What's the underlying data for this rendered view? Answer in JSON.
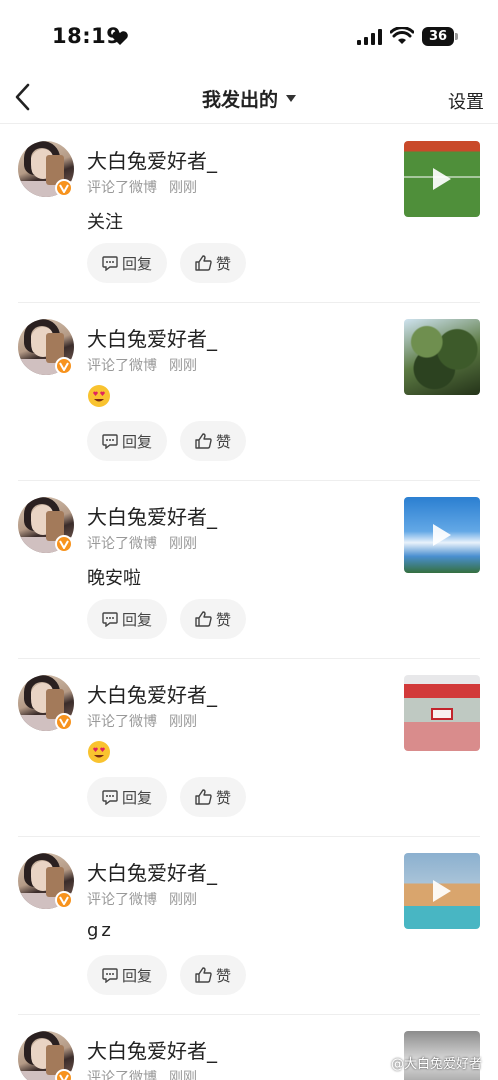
{
  "status_bar": {
    "time": "18:19",
    "battery": "36"
  },
  "header": {
    "title": "我发出的",
    "settings_label": "设置"
  },
  "colors": {
    "badge": "#f7931e",
    "pill_bg": "#f4f4f4",
    "meta_text": "#999999"
  },
  "items": [
    {
      "user": "大白兔爱好者_",
      "action": "评论了微博",
      "time": "刚刚",
      "comment": "关注",
      "thumbnail": "soccer-video-thumbnail",
      "is_video": true,
      "reply_label": "回复",
      "like_label": "赞"
    },
    {
      "user": "大白兔爱好者_",
      "action": "评论了微博",
      "time": "刚刚",
      "comment_emoji": "heart-eyes-emoji",
      "thumbnail": "tree-photo-thumbnail",
      "is_video": false,
      "reply_label": "回复",
      "like_label": "赞"
    },
    {
      "user": "大白兔爱好者_",
      "action": "评论了微博",
      "time": "刚刚",
      "comment": "晚安啦",
      "thumbnail": "sky-video-thumbnail",
      "is_video": true,
      "reply_label": "回复",
      "like_label": "赞"
    },
    {
      "user": "大白兔爱好者_",
      "action": "评论了微博",
      "time": "刚刚",
      "comment_emoji": "heart-eyes-emoji",
      "thumbnail": "beach-photo-thumbnail",
      "is_video": false,
      "reply_label": "回复",
      "like_label": "赞"
    },
    {
      "user": "大白兔爱好者_",
      "action": "评论了微博",
      "time": "刚刚",
      "comment": "gz",
      "thumbnail": "desert-video-thumbnail",
      "is_video": true,
      "reply_label": "回复",
      "like_label": "赞"
    },
    {
      "user": "大白兔爱好者_",
      "action": "评论了微博",
      "time": "刚刚",
      "thumbnail": "rocks-photo-thumbnail",
      "is_video": false
    }
  ],
  "watermark": "@大白兔爱好者"
}
